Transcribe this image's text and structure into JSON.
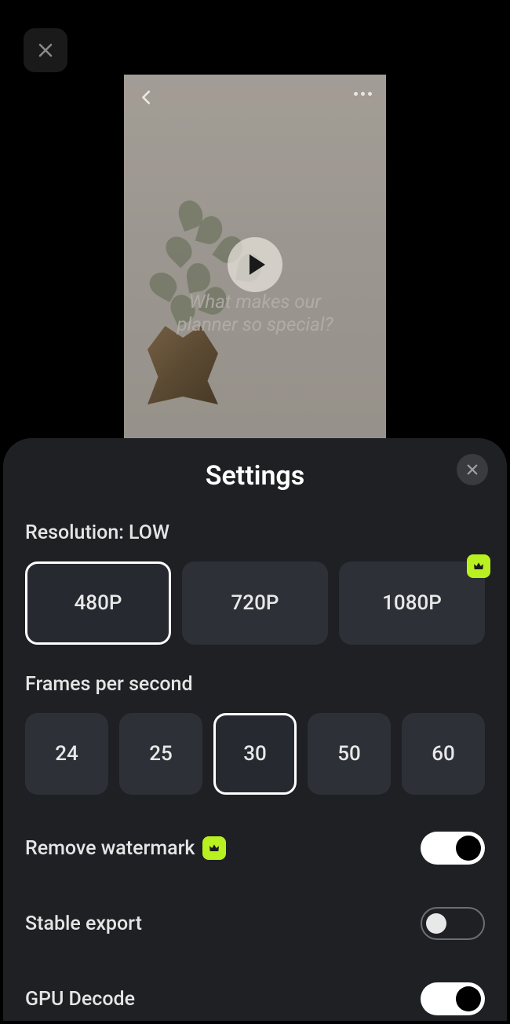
{
  "topbar": {
    "close_icon": "close"
  },
  "preview": {
    "back_icon": "chevron-left",
    "more_icon": "more-horizontal",
    "caption_line1": "What makes our",
    "caption_line2": "planner so special?"
  },
  "sheet": {
    "title": "Settings",
    "close_icon": "close",
    "resolution": {
      "label": "Resolution: LOW",
      "options": [
        "480P",
        "720P",
        "1080P"
      ],
      "selected_index": 0,
      "premium_index": 2
    },
    "fps": {
      "label": "Frames per second",
      "options": [
        "24",
        "25",
        "30",
        "50",
        "60"
      ],
      "selected_index": 2
    },
    "toggles": {
      "remove_watermark": {
        "label": "Remove watermark",
        "premium": true,
        "on": true
      },
      "stable_export": {
        "label": "Stable export",
        "premium": false,
        "on": false
      },
      "gpu_decode": {
        "label": "GPU Decode",
        "premium": false,
        "on": true
      }
    }
  },
  "colors": {
    "accent": "#b8f020",
    "sheet_bg": "#1e2024",
    "chip_bg": "#2d3036"
  }
}
